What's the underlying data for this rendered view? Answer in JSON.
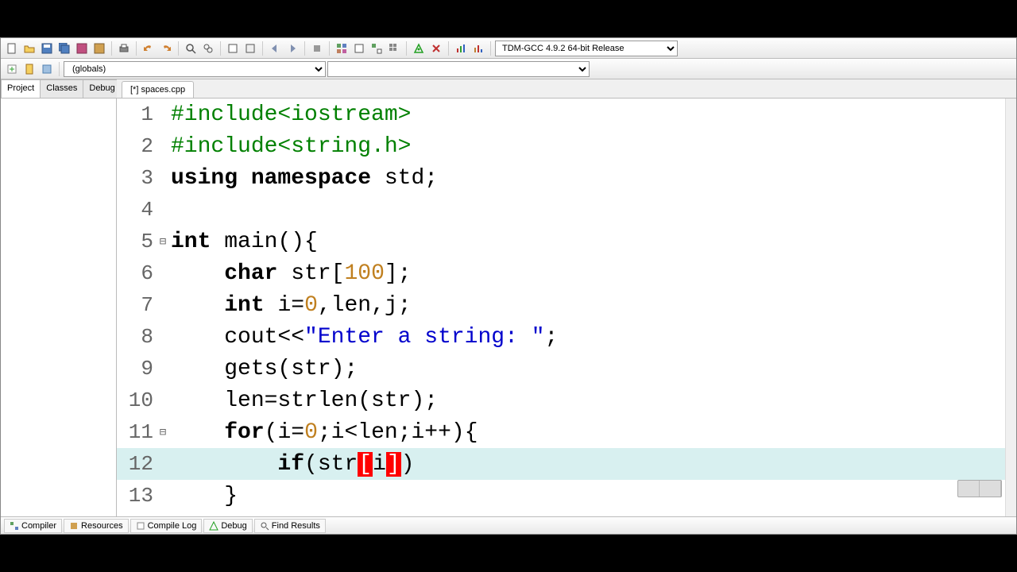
{
  "compiler_combo": "TDM-GCC 4.9.2 64-bit Release",
  "scope_combo": "(globals)",
  "left_tabs": [
    "Project",
    "Classes",
    "Debug"
  ],
  "file_tab": "[*] spaces.cpp",
  "bottom_tabs": [
    "Compiler",
    "Resources",
    "Compile Log",
    "Debug",
    "Find Results"
  ],
  "code": {
    "l1": "#include<iostream>",
    "l2": "#include<string.h>",
    "l3_a": "using",
    "l3_b": "namespace",
    "l3_c": "std;",
    "l5_a": "int",
    "l5_b": "main",
    "l5_c": "(){",
    "l6_a": "char",
    "l6_b": "str[",
    "l6_num": "100",
    "l6_c": "];",
    "l7_a": "int",
    "l7_b": "i=",
    "l7_num": "0",
    "l7_c": ",len,j;",
    "l8_a": "cout<<",
    "l8_str": "\"Enter a string: \"",
    "l8_b": ";",
    "l9": "gets(str);",
    "l10": "len=strlen(str);",
    "l11_a": "for",
    "l11_b": "(i=",
    "l11_n1": "0",
    "l11_c": ";i<len;i++){",
    "l12_a": "if",
    "l12_b": "(str",
    "l12_br1": "[",
    "l12_c": "i",
    "l12_br2": "]",
    "l12_d": ")",
    "l13": "}"
  },
  "line_numbers": [
    "1",
    "2",
    "3",
    "4",
    "5",
    "6",
    "7",
    "8",
    "9",
    "10",
    "11",
    "12",
    "13"
  ],
  "icons": {
    "new": "file-new",
    "open": "file-open",
    "save": "save",
    "saveall": "save-all",
    "undo": "undo",
    "redo": "redo",
    "find": "find",
    "replace": "replace",
    "compile": "compile",
    "run": "run"
  }
}
